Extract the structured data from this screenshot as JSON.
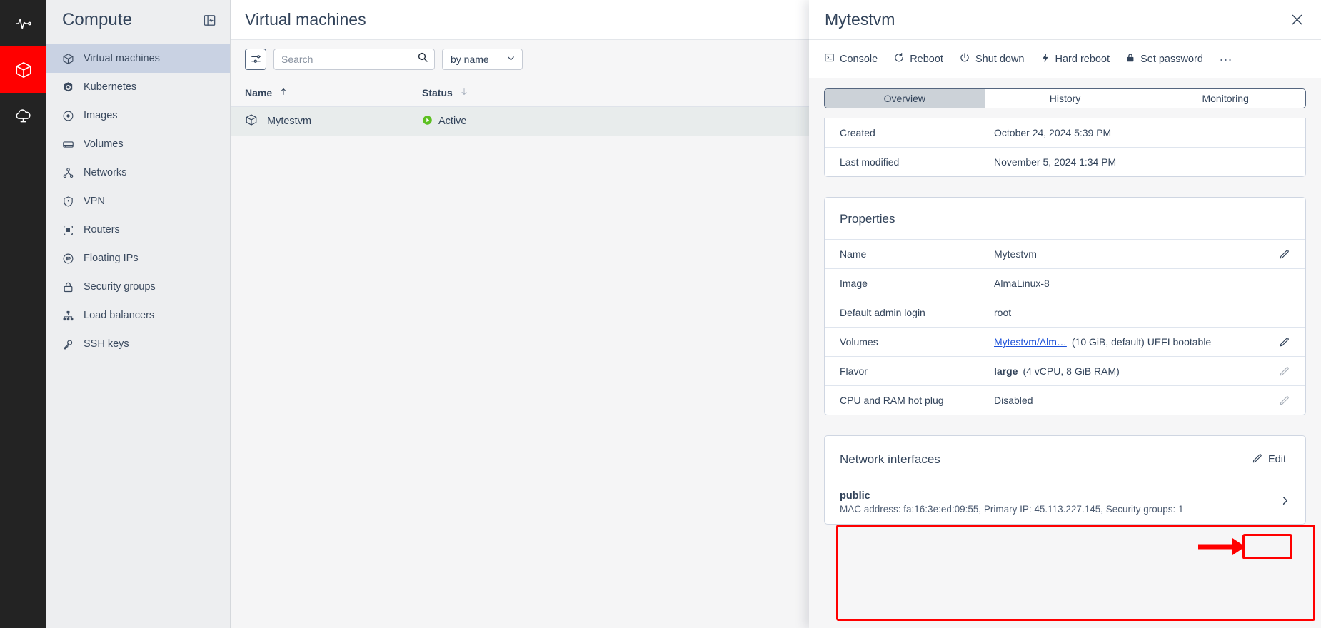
{
  "rail": {
    "items": [
      {
        "name": "monitoring-pulse-icon",
        "active": false
      },
      {
        "name": "compute-cube-icon",
        "active": true
      },
      {
        "name": "cloud-icon",
        "active": false
      }
    ]
  },
  "sidebar": {
    "title": "Compute",
    "collapse_icon": "panel-collapse-icon",
    "items": [
      {
        "label": "Virtual machines",
        "icon": "cube-icon",
        "active": true
      },
      {
        "label": "Kubernetes",
        "icon": "kubernetes-icon",
        "active": false
      },
      {
        "label": "Images",
        "icon": "disc-icon",
        "active": false
      },
      {
        "label": "Volumes",
        "icon": "drive-icon",
        "active": false
      },
      {
        "label": "Networks",
        "icon": "network-icon",
        "active": false
      },
      {
        "label": "VPN",
        "icon": "shield-icon",
        "active": false
      },
      {
        "label": "Routers",
        "icon": "router-icon",
        "active": false
      },
      {
        "label": "Floating IPs",
        "icon": "floating-ip-icon",
        "active": false
      },
      {
        "label": "Security groups",
        "icon": "lock-icon",
        "active": false
      },
      {
        "label": "Load balancers",
        "icon": "load-balancer-icon",
        "active": false
      },
      {
        "label": "SSH keys",
        "icon": "key-icon",
        "active": false
      }
    ]
  },
  "main": {
    "page_title": "Virtual machines",
    "toolbar": {
      "filter_icon": "filter-sliders-icon",
      "search_placeholder": "Search",
      "search_value": "",
      "search_icon": "search-icon",
      "sort_value": "by name",
      "sort_chevron": "chevron-down-icon"
    },
    "table": {
      "columns": [
        {
          "label": "Name",
          "sort": "ascending",
          "sort_icon": "arrow-up-icon"
        },
        {
          "label": "Status",
          "sort": "descending",
          "sort_icon": "arrow-down-icon"
        }
      ],
      "rows": [
        {
          "icon": "cube-icon",
          "name": "Mytestvm",
          "status": "Active",
          "status_icon": "play-circle-icon",
          "status_color": "#5cc021",
          "selected": true
        }
      ]
    }
  },
  "panel": {
    "title": "Mytestvm",
    "close_icon": "close-icon",
    "actions": [
      {
        "label": "Console",
        "icon": "terminal-icon"
      },
      {
        "label": "Reboot",
        "icon": "reboot-icon"
      },
      {
        "label": "Shut down",
        "icon": "power-icon"
      },
      {
        "label": "Hard reboot",
        "icon": "bolt-icon"
      },
      {
        "label": "Set password",
        "icon": "lock-icon"
      }
    ],
    "more_label": "…",
    "tabs": [
      {
        "label": "Overview",
        "active": true
      },
      {
        "label": "History",
        "active": false
      },
      {
        "label": "Monitoring",
        "active": false
      }
    ],
    "info_rows": [
      {
        "key": "Created",
        "value": "October 24, 2024 5:39 PM"
      },
      {
        "key": "Last modified",
        "value": "November 5, 2024 1:34 PM"
      }
    ],
    "properties": {
      "title": "Properties",
      "rows": [
        {
          "key": "Name",
          "value": "Mytestvm",
          "editable": true
        },
        {
          "key": "Image",
          "value": "AlmaLinux-8",
          "editable": false
        },
        {
          "key": "Default admin login",
          "value": "root",
          "editable": false
        },
        {
          "key": "Volumes",
          "link": "Mytestvm/Alm…",
          "value": "(10 GiB, default) UEFI bootable",
          "editable": true
        },
        {
          "key": "Flavor",
          "bold": "large",
          "value": "(4 vCPU, 8 GiB RAM)",
          "editable": true,
          "dim": true
        },
        {
          "key": "CPU and RAM hot plug",
          "value": "Disabled",
          "editable": true,
          "dim": true
        }
      ]
    },
    "network_interfaces": {
      "title": "Network interfaces",
      "edit_label": "Edit",
      "edit_icon": "pencil-icon",
      "items": [
        {
          "name": "public",
          "meta": "MAC address: fa:16:3e:ed:09:55, Primary IP: 45.113.227.145, Security groups: 1",
          "chevron": "chevron-right-icon"
        }
      ]
    }
  },
  "annotation": {
    "highlight_color": "#ff0000",
    "arrow_icon": "right-arrow-annotation"
  }
}
